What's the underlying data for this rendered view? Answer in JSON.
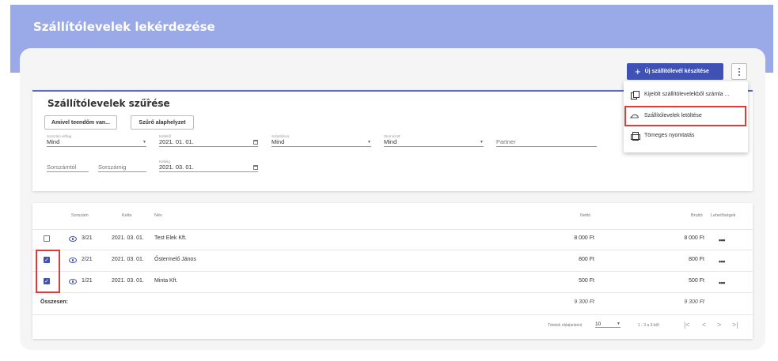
{
  "page": {
    "title": "Szállítólevelek lekérdezése"
  },
  "toolbar": {
    "new_label": "Új szállítólevél készítése"
  },
  "menu": {
    "items": [
      {
        "label": "Kijelölt szállítólevelekből számla ...",
        "icon": "copy-icon"
      },
      {
        "label": "Szállítólevelek letöltése",
        "icon": "cloud-download-icon"
      },
      {
        "label": "Tömeges nyomtatás",
        "icon": "print-icon"
      }
    ]
  },
  "filters": {
    "title": "Szállítólevelek szűrése",
    "todo_button": "Amivel teendőm van...",
    "reset_button": "Szűrő alaphelyzet",
    "prefix": {
      "label": "Sorszám előtag",
      "value": "Mind"
    },
    "issued_from": {
      "label": "Keltétől",
      "value": "2021. 01. 01."
    },
    "invoiced": {
      "label": "Számlázva",
      "value": "Mind"
    },
    "cancelled": {
      "label": "Stornózott",
      "value": "Mind"
    },
    "partner": {
      "placeholder": "Partner"
    },
    "serial_from": {
      "placeholder": "Sorszámtól"
    },
    "serial_to": {
      "placeholder": "Sorszámig"
    },
    "issued_to": {
      "label": "Keltéig",
      "value": "2021. 03. 01."
    }
  },
  "table": {
    "columns": {
      "serial": "Sorszám",
      "date": "Kelte",
      "name": "Név",
      "net": "Nettó",
      "gross": "Bruttó",
      "options": "Lehetőségek"
    },
    "rows": [
      {
        "checked": false,
        "serial": "3/21",
        "date": "2021. 03. 01.",
        "name": "Test Elek Kft.",
        "net": "8 000 Ft",
        "gross": "8 000 Ft"
      },
      {
        "checked": true,
        "serial": "2/21",
        "date": "2021. 03. 01.",
        "name": "Őstermelő János",
        "net": "800 Ft",
        "gross": "800 Ft"
      },
      {
        "checked": true,
        "serial": "1/21",
        "date": "2021. 03. 01.",
        "name": "Minta Kft.",
        "net": "500 Ft",
        "gross": "500 Ft"
      }
    ],
    "totals": {
      "label": "Összesen:",
      "net": "9 300 Ft",
      "gross": "9 300 Ft"
    }
  },
  "pagination": {
    "per_page_label": "Tételek oldalanként",
    "per_page": "10",
    "range": "1 - 3 a 3-ből"
  },
  "colors": {
    "banner": "#9aa9e8",
    "primary": "#3f51b5",
    "highlight": "#e53935"
  }
}
